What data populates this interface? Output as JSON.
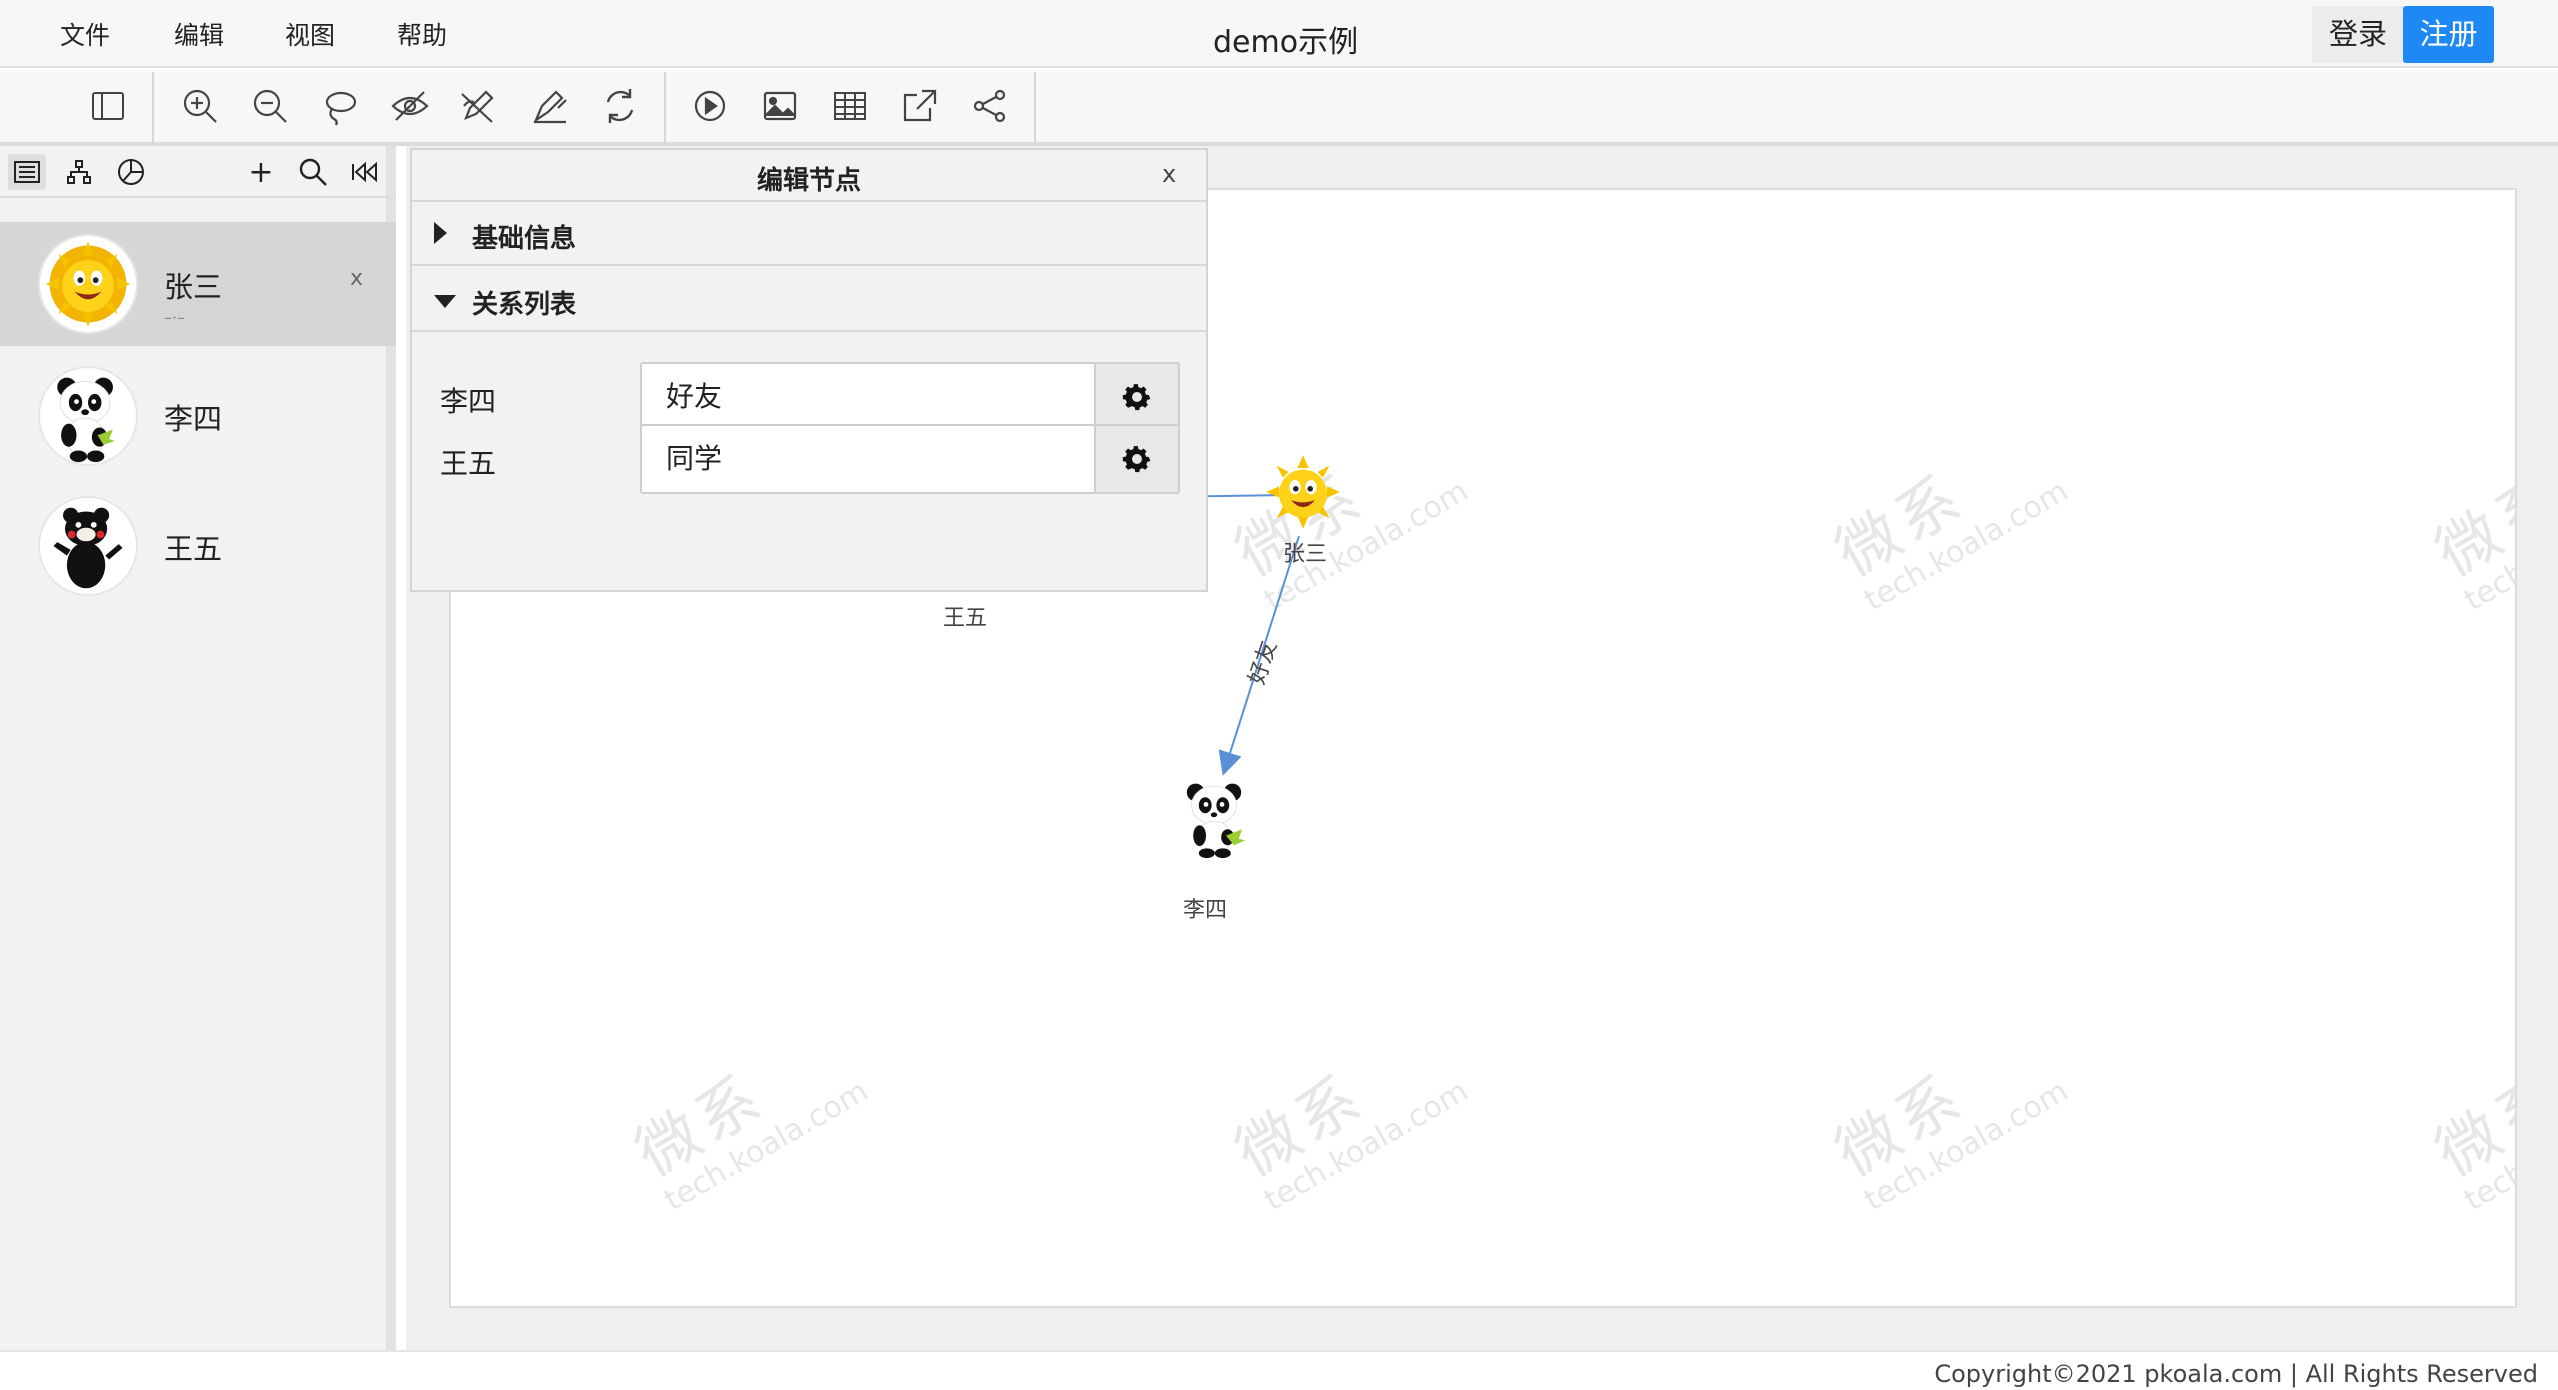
{
  "menu": {
    "file": "文件",
    "edit": "编辑",
    "view": "视图",
    "help": "帮助"
  },
  "app": {
    "title": "demo示例"
  },
  "auth": {
    "login": "登录",
    "register": "注册",
    "register_color": "#1e88f5"
  },
  "toolbar_icons": [
    "sidebar-toggle-icon",
    "zoom-in-icon",
    "zoom-out-icon",
    "lasso-icon",
    "hide-icon",
    "edit-link-icon",
    "auto-layout-icon",
    "refresh-icon",
    "play-icon",
    "image-icon",
    "table-icon",
    "export-icon",
    "share-icon"
  ],
  "left_panel": {
    "tabs": [
      "list-view-icon",
      "tree-view-icon",
      "pie-chart-icon"
    ],
    "actions": {
      "add": "+"
    },
    "people": [
      {
        "name": "张三",
        "sub": "–·–",
        "close": "x",
        "avatar": "sun"
      },
      {
        "name": "李四",
        "avatar": "panda"
      },
      {
        "name": "王五",
        "avatar": "bear"
      }
    ]
  },
  "graph": {
    "watermark": {
      "main": "微系",
      "sub": "tech.koala.com"
    },
    "nodes": {
      "zhangsan": "张三",
      "lisi": "李四",
      "wangwu": "王五"
    },
    "edge_label": "好友",
    "edge_color": "#5b8fd8"
  },
  "edit_panel": {
    "title": "编辑节点",
    "close": "x",
    "section_basic": "基础信息",
    "section_relations": "关系列表",
    "relations": [
      {
        "name": "李四",
        "type": "好友"
      },
      {
        "name": "王五",
        "type": "同学"
      }
    ]
  },
  "footer": {
    "copyright": "Copyright©2021 pkoala.com | All Rights Reserved"
  }
}
